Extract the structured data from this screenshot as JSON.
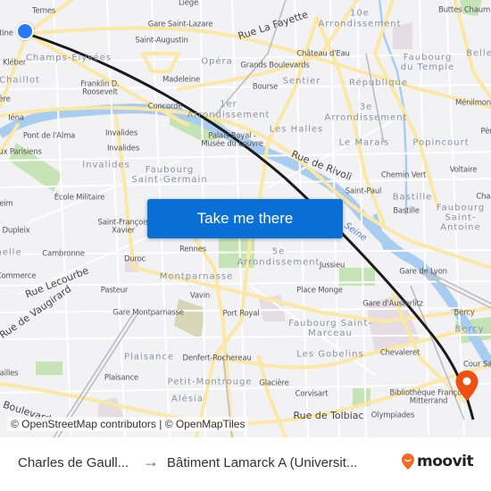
{
  "map": {
    "attribution": "© OpenStreetMap contributors | © OpenMapTiles",
    "route_button_label": "Take me there",
    "origin_marker_color": "#2979ff",
    "destination_marker_color": "#f0500f",
    "route_line_color": "#1a1a1a",
    "labels": {
      "liege": "Liège",
      "ternes": "Ternes",
      "gare_saint_lazare": "Gare Saint-Lazare",
      "rue_la_fayette": "Rue La Fayette",
      "arr10_num": "10e",
      "arr10": "Arrondissement",
      "buttes_chaumont": "Buttes Chaum",
      "etoile_partial": "tine",
      "saint_augustin": "Saint-Augustin",
      "champs_elysees": "Champs-Elysées",
      "chateau_deau": "Château d'Eau",
      "faubourg_du_temple": "Faubourg du Temple",
      "belle": "Belle",
      "kleber": "Kléber",
      "opera": "Opéra",
      "grands_boulevards": "Grands Boulevards",
      "chaillot": "Chaillot",
      "madeleine": "Madeleine",
      "sentier": "Sentier",
      "republique": "République",
      "franklin": "Franklin D. Roosevelt",
      "bourse": "Bourse",
      "iere": "ière",
      "arr1_num": "1er",
      "arr1": "Arrondissement",
      "arr3_num": "3e",
      "arr3": "Arrondissement",
      "menilmontant": "Ménilmon",
      "iena": "Iéna",
      "concorde": "Concorde",
      "pont_alma": "Pont de l'Alma",
      "invalides1": "Invalides",
      "palais_royal": "Palais Royal - Musée du Louvre",
      "les_halles": "Les Halles",
      "pere": "Pèr",
      "egouts": "aux Parisiens",
      "invalides2": "Invalides",
      "le_marais": "Le Marais",
      "popincourt": "Popincourt",
      "invalides_district": "Invalides",
      "faubourg_saint_germain": "Faubourg Saint-Germain",
      "rue_de_rivoli": "Rue de Rivoli",
      "chemin_vert": "Chemin Vert",
      "voltaire": "Voltaire",
      "ecole_militaire": "École Militaire",
      "saint_paul": "Saint-Paul",
      "bastille_district": "Bastille",
      "charonne": "Char",
      "eim": "eim",
      "saint_francois": "Saint-François Xavier",
      "bastille": "Bastille",
      "faubourg_saint_antoine": "Faubourg Saint-Antoine",
      "seine": "Seine",
      "dupleix": "Dupleix",
      "grenelle": "nelle",
      "cambronne": "Cambronne",
      "rennes": "Rennes",
      "arr5_num": "5e",
      "arr5": "Arrondissement",
      "jussieu": "Jussieu",
      "gare_de_lyon": "Gare de Lyon",
      "duroc": "Duroc",
      "commerce": "Commerce",
      "rue_lecourbe": "Rue Lecourbe",
      "montparnasse": "Montparnasse",
      "pasteur": "Pasteur",
      "vavin": "Vavin",
      "place_monge": "Place Monge",
      "rue_de_vaugirard": "Rue de Vaugirard",
      "gare_montparnasse": "Gare Montparnasse",
      "port_royal": "Port Royal",
      "gare_austerlitz": "Gare d'Austerlitz",
      "bercy": "Bercy",
      "faubourg_saint_marceau": "Faubourg Saint-Marceau",
      "bercy_district": "Bercy",
      "plaisance_district": "Plaisance",
      "denfert": "Denfert-Rochereau",
      "les_gobelins": "Les Gobelins",
      "chevaleret": "Chevaleret",
      "cour_saint": "Cour Sa",
      "versailles": "ailles",
      "plaisance": "Plaisance",
      "petit_montrouge": "Petit-Montrouge",
      "glaciere": "Glacière",
      "corvisart": "Corvisart",
      "bibliotheque": "Bibliothèque François Mitterrand",
      "alesia": "Alésia",
      "boulevard": "Boulevard",
      "rue_de_tolbiac": "Rue de Tolbiac",
      "olympiades": "Olympiades"
    }
  },
  "footer": {
    "from": "Charles de Gaull...",
    "arrow": "→",
    "to": "Bâtiment Lamarck A (Universit...",
    "logo_text": "moovit",
    "logo_color": "#f26b21"
  }
}
